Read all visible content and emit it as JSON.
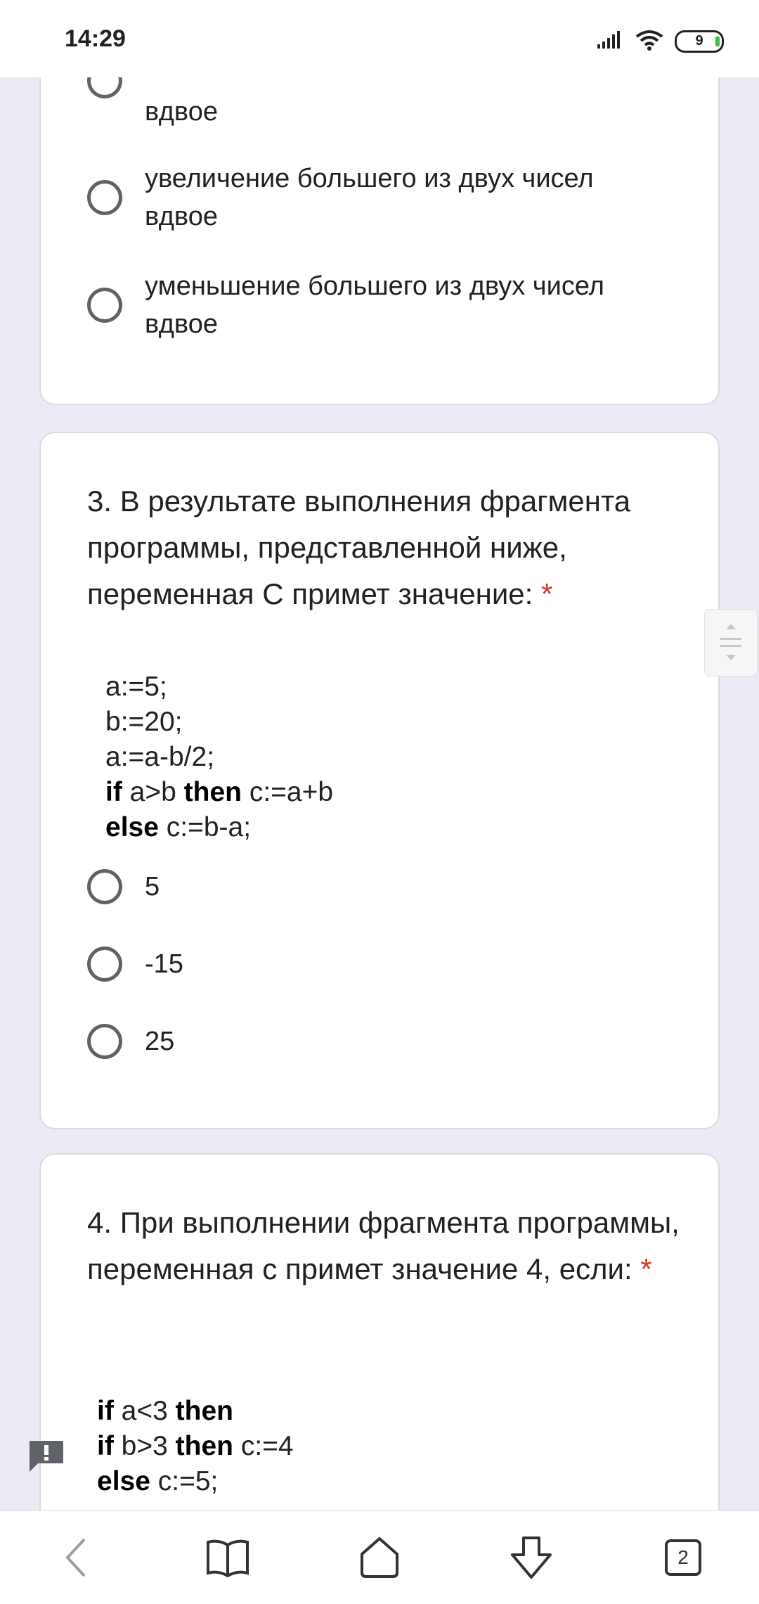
{
  "status_bar": {
    "time": "14:29",
    "battery_level": "9"
  },
  "card_prev": {
    "partial_option_text": "вдвое",
    "options": [
      "увеличение большего из двух чисел вдвое",
      "уменьшение большего из двух чисел вдвое"
    ]
  },
  "question3": {
    "title": "3. В результате выполнения фрагмента программы, представленной ниже, переменная С примет значение:",
    "required_mark": "*",
    "code": {
      "line1": "a:=5;",
      "line2": "b:=20;",
      "line3": "a:=a-b/2;",
      "line4_kw1": "if",
      "line4_mid": " a>b ",
      "line4_kw2": "then",
      "line4_end": " c:=a+b",
      "line5_kw": "else",
      "line5_end": " c:=b-a;"
    },
    "options": [
      "5",
      "-15",
      "25"
    ]
  },
  "question4": {
    "title": "4. При выполнении фрагмента программы, переменная с примет значение 4, если:",
    "required_mark": "*",
    "code": {
      "line1_kw1": "if",
      "line1_mid": " a<3 ",
      "line1_kw2": "then",
      "line2_kw1": "if",
      "line2_mid": " b>3 ",
      "line2_kw2": "then",
      "line2_end": " c:=4",
      "line3_kw": "else",
      "line3_end": " c:=5;"
    }
  },
  "nav_bar": {
    "tab_count": "2"
  }
}
